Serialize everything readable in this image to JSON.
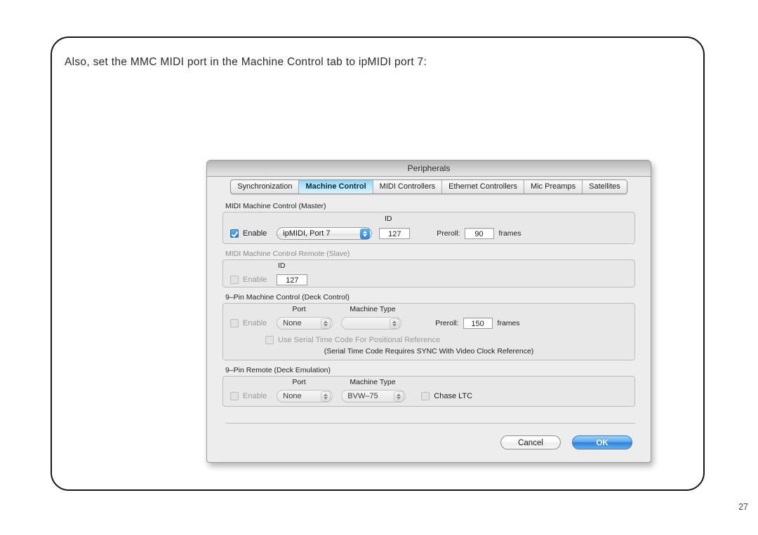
{
  "slide": {
    "heading": "Also, set the MMC MIDI port in the Machine Control tab to ipMIDI port 7:",
    "page_number": "27"
  },
  "dialog": {
    "title": "Peripherals",
    "tabs": [
      {
        "label": "Synchronization",
        "selected": false
      },
      {
        "label": "Machine Control",
        "selected": true
      },
      {
        "label": "MIDI Controllers",
        "selected": false
      },
      {
        "label": "Ethernet Controllers",
        "selected": false
      },
      {
        "label": "Mic Preamps",
        "selected": false
      },
      {
        "label": "Satellites",
        "selected": false
      }
    ],
    "groups": {
      "mmc_master": {
        "title": "MIDI Machine Control (Master)",
        "enable_label": "Enable",
        "enable_checked": true,
        "port_value": "ipMIDI, Port 7",
        "id_header": "ID",
        "id_value": "127",
        "preroll_label": "Preroll:",
        "preroll_value": "90",
        "frames_label": "frames"
      },
      "mmc_slave": {
        "title": "MIDI Machine Control Remote (Slave)",
        "enable_label": "Enable",
        "enable_checked": false,
        "id_header": "ID",
        "id_value": "127"
      },
      "ninepin_deck_control": {
        "title": "9–Pin Machine Control (Deck Control)",
        "enable_label": "Enable",
        "enable_checked": false,
        "port_header": "Port",
        "port_value": "None",
        "machine_type_header": "Machine Type",
        "machine_type_value": "",
        "preroll_label": "Preroll:",
        "preroll_value": "150",
        "frames_label": "frames",
        "serial_tc_label": "Use Serial Time Code For Positional Reference",
        "serial_tc_checked": false,
        "note": "(Serial Time Code Requires SYNC With Video Clock Reference)"
      },
      "ninepin_deck_emulation": {
        "title": "9–Pin Remote (Deck Emulation)",
        "enable_label": "Enable",
        "enable_checked": false,
        "port_header": "Port",
        "port_value": "None",
        "machine_type_header": "Machine Type",
        "machine_type_value": "BVW–75",
        "chase_ltc_label": "Chase LTC",
        "chase_ltc_checked": false
      }
    },
    "footer": {
      "cancel_label": "Cancel",
      "ok_label": "OK"
    }
  },
  "colors": {
    "selected_tab": "#8fd3f7",
    "checkbox_on": "#2b7fd4",
    "default_button": "#2f7fdb",
    "dialog_bg": "#ededed",
    "card_border": "#16161a"
  }
}
